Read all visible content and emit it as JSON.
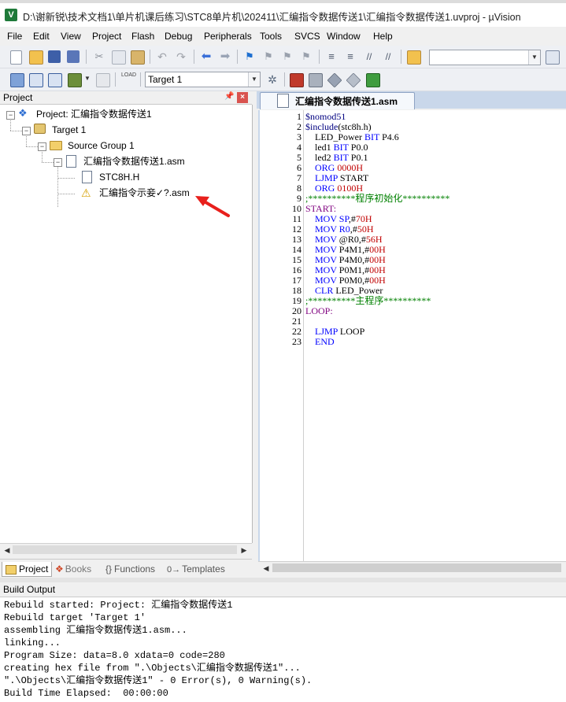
{
  "window": {
    "title": "D:\\谢新锐\\技术文档1\\单片机课后练习\\STC8单片机\\202411\\汇编指令数据传送1\\汇编指令数据传送1.uvproj - µVision",
    "icon_label": "V"
  },
  "menu": [
    "File",
    "Edit",
    "View",
    "Project",
    "Flash",
    "Debug",
    "Peripherals",
    "Tools",
    "SVCS",
    "Window",
    "Help"
  ],
  "toolbar2": {
    "target_combo_value": "Target 1",
    "load_label": "LOAD"
  },
  "project_panel": {
    "header": "Project",
    "tree": {
      "project": "Project: 汇编指令数据传送1",
      "target": "Target 1",
      "group": "Source Group 1",
      "file": "汇编指令数据传送1.asm",
      "include": "STC8H.H",
      "missing_file": "汇编指令示妾✓?.asm"
    },
    "tabs": [
      "Project",
      "Books",
      "Functions",
      "Templates"
    ],
    "tab_glyphs": [
      "{}",
      "0→"
    ]
  },
  "editor": {
    "tab_label": "汇编指令数据传送1.asm",
    "lines": [
      {
        "n": "1",
        "parts": [
          [
            "dir",
            "$nomod51"
          ]
        ]
      },
      {
        "n": "2",
        "parts": [
          [
            "dir",
            "$include"
          ],
          [
            "text",
            "(stc8h.h)"
          ]
        ]
      },
      {
        "n": "3",
        "parts": [
          [
            "text",
            "    LED_Power "
          ],
          [
            "kw",
            "BIT"
          ],
          [
            "text",
            " P4.6"
          ]
        ]
      },
      {
        "n": "4",
        "parts": [
          [
            "text",
            "    led1 "
          ],
          [
            "kw",
            "BIT"
          ],
          [
            "text",
            " P0.0"
          ]
        ]
      },
      {
        "n": "5",
        "parts": [
          [
            "text",
            "    led2 "
          ],
          [
            "kw",
            "BIT"
          ],
          [
            "text",
            " P0.1"
          ]
        ]
      },
      {
        "n": "6",
        "parts": [
          [
            "text",
            "    "
          ],
          [
            "kw",
            "ORG"
          ],
          [
            "text",
            " "
          ],
          [
            "num",
            "0000H"
          ]
        ]
      },
      {
        "n": "7",
        "parts": [
          [
            "text",
            "    "
          ],
          [
            "kw",
            "LJMP"
          ],
          [
            "text",
            " START"
          ]
        ]
      },
      {
        "n": "8",
        "parts": [
          [
            "text",
            "    "
          ],
          [
            "kw",
            "ORG"
          ],
          [
            "text",
            " "
          ],
          [
            "num",
            "0100H"
          ]
        ]
      },
      {
        "n": "9",
        "parts": [
          [
            "cmt",
            ";**********程序初始化**********"
          ]
        ]
      },
      {
        "n": "10",
        "parts": [
          [
            "lbl",
            "START:"
          ]
        ]
      },
      {
        "n": "11",
        "parts": [
          [
            "text",
            "    "
          ],
          [
            "kw",
            "MOV"
          ],
          [
            "text",
            " "
          ],
          [
            "kw",
            "SP"
          ],
          [
            "text",
            ",#"
          ],
          [
            "num",
            "70H"
          ]
        ]
      },
      {
        "n": "12",
        "parts": [
          [
            "text",
            "    "
          ],
          [
            "kw",
            "MOV"
          ],
          [
            "text",
            " "
          ],
          [
            "kw",
            "R0"
          ],
          [
            "text",
            ",#"
          ],
          [
            "num",
            "50H"
          ]
        ]
      },
      {
        "n": "13",
        "parts": [
          [
            "text",
            "    "
          ],
          [
            "kw",
            "MOV"
          ],
          [
            "text",
            " @R0,#"
          ],
          [
            "num",
            "56H"
          ]
        ]
      },
      {
        "n": "14",
        "parts": [
          [
            "text",
            "    "
          ],
          [
            "kw",
            "MOV"
          ],
          [
            "text",
            " P4M1,#"
          ],
          [
            "num",
            "00H"
          ]
        ]
      },
      {
        "n": "15",
        "parts": [
          [
            "text",
            "    "
          ],
          [
            "kw",
            "MOV"
          ],
          [
            "text",
            " P4M0,#"
          ],
          [
            "num",
            "00H"
          ]
        ]
      },
      {
        "n": "16",
        "parts": [
          [
            "text",
            "    "
          ],
          [
            "kw",
            "MOV"
          ],
          [
            "text",
            " P0M1,#"
          ],
          [
            "num",
            "00H"
          ]
        ]
      },
      {
        "n": "17",
        "parts": [
          [
            "text",
            "    "
          ],
          [
            "kw",
            "MOV"
          ],
          [
            "text",
            " P0M0,#"
          ],
          [
            "num",
            "00H"
          ]
        ]
      },
      {
        "n": "18",
        "parts": [
          [
            "text",
            "    "
          ],
          [
            "kw",
            "CLR"
          ],
          [
            "text",
            " LED_Power"
          ]
        ]
      },
      {
        "n": "19",
        "parts": [
          [
            "cmt",
            ";**********主程序**********"
          ]
        ]
      },
      {
        "n": "20",
        "parts": [
          [
            "lbl",
            "LOOP:"
          ]
        ]
      },
      {
        "n": "21",
        "parts": []
      },
      {
        "n": "22",
        "parts": [
          [
            "text",
            "    "
          ],
          [
            "kw",
            "LJMP"
          ],
          [
            "text",
            " LOOP"
          ]
        ]
      },
      {
        "n": "23",
        "parts": [
          [
            "text",
            "    "
          ],
          [
            "kw",
            "END"
          ]
        ]
      }
    ]
  },
  "build_output": {
    "header": "Build Output",
    "lines": [
      "Rebuild started: Project: 汇编指令数据传送1",
      "Rebuild target 'Target 1'",
      "assembling 汇编指令数据传送1.asm...",
      "linking...",
      "Program Size: data=8.0 xdata=0 code=280",
      "creating hex file from \".\\Objects\\汇编指令数据传送1\"...",
      "\".\\Objects\\汇编指令数据传送1\" - 0 Error(s), 0 Warning(s).",
      "Build Time Elapsed:  00:00:00"
    ]
  },
  "colors": {
    "keyword": "#0000ff",
    "number": "#c00000",
    "comment": "#008000",
    "label": "#7f007f",
    "annotation_arrow": "#e8201c"
  }
}
